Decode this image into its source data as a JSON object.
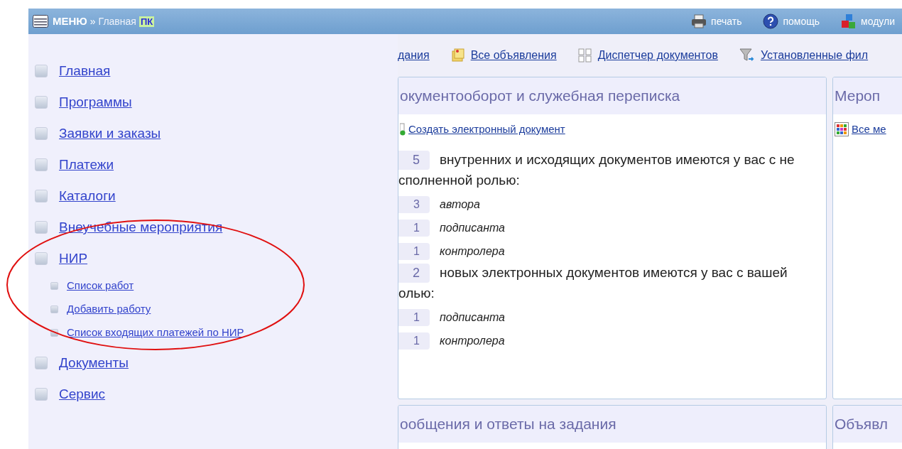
{
  "header": {
    "menu_label": "МЕНЮ",
    "separator": "»",
    "breadcrumb": "Главная",
    "badge": "ПК",
    "actions": [
      {
        "label": "печать"
      },
      {
        "label": "помощь"
      },
      {
        "label": "модули"
      }
    ]
  },
  "menu": {
    "items": [
      {
        "label": "Главная"
      },
      {
        "label": "Программы"
      },
      {
        "label": "Заявки и заказы"
      },
      {
        "label": "Платежи"
      },
      {
        "label": "Каталоги"
      },
      {
        "label": "Внеучебные мероприятия"
      },
      {
        "label": "НИР",
        "children": [
          {
            "label": "Список работ"
          },
          {
            "label": "Добавить работу"
          },
          {
            "label": "Список входящих платежей по НИР"
          }
        ]
      },
      {
        "label": "Документы"
      },
      {
        "label": "Сервис"
      }
    ]
  },
  "toolbar": [
    {
      "label": "дания"
    },
    {
      "label": "Все объявления"
    },
    {
      "label": "Диспетчер документов"
    },
    {
      "label": "Установленные фил"
    }
  ],
  "panels": [
    {
      "title": "окументооборот и служебная переписка",
      "link": "Создать электронный документ",
      "stats": [
        {
          "kind": "summary",
          "count": "5",
          "text": "внутренних и исходящих документов имеются у вас с не",
          "continuation": "сполненной ролью:"
        },
        {
          "kind": "role",
          "count": "3",
          "text": "автора"
        },
        {
          "kind": "role",
          "count": "1",
          "text": "подписанта"
        },
        {
          "kind": "role",
          "count": "1",
          "text": "контролера"
        },
        {
          "kind": "summary",
          "count": "2",
          "text": "новых электронных документов имеются у вас с вашей",
          "continuation": "олью:"
        },
        {
          "kind": "role",
          "count": "1",
          "text": "подписанта"
        },
        {
          "kind": "role",
          "count": "1",
          "text": "контролера"
        }
      ]
    },
    {
      "title": "Мероп",
      "link": "Все ме"
    },
    {
      "title": "ообщения и ответы на задания"
    },
    {
      "title": "Объявл"
    }
  ]
}
